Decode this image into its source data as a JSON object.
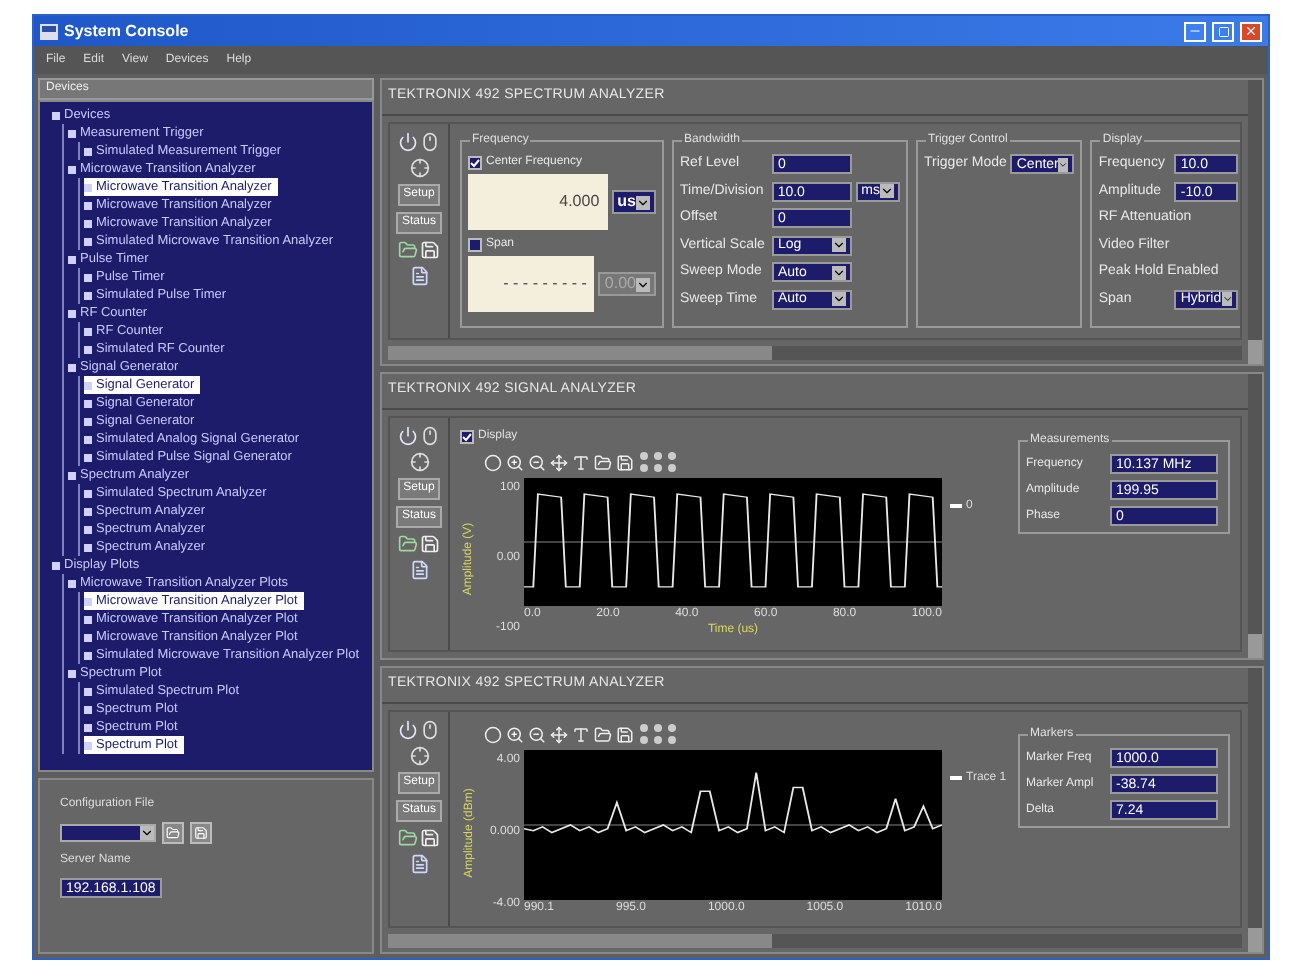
{
  "window": {
    "title": "System Console"
  },
  "menu": [
    "File",
    "Edit",
    "View",
    "Devices",
    "Help"
  ],
  "sidebar": {
    "tab": "Devices",
    "tree": [
      {
        "label": "Devices",
        "selected": false,
        "children": [
          {
            "label": "Measurement Trigger",
            "selected": false,
            "children": [
              {
                "label": "Simulated Measurement Trigger",
                "selected": false
              }
            ]
          },
          {
            "label": "Microwave Transition Analyzer",
            "selected": false,
            "children": [
              {
                "label": "Microwave Transition Analyzer",
                "selected": true
              },
              {
                "label": "Microwave Transition Analyzer",
                "selected": false
              },
              {
                "label": "Microwave Transition Analyzer",
                "selected": false
              },
              {
                "label": "Simulated Microwave Transition Analyzer",
                "selected": false
              }
            ]
          },
          {
            "label": "Pulse Timer",
            "selected": false,
            "children": [
              {
                "label": "Pulse Timer",
                "selected": false
              },
              {
                "label": "Simulated Pulse Timer",
                "selected": false
              }
            ]
          },
          {
            "label": "RF Counter",
            "selected": false,
            "children": [
              {
                "label": "RF Counter",
                "selected": false
              },
              {
                "label": "Simulated RF Counter",
                "selected": false
              }
            ]
          },
          {
            "label": "Signal Generator",
            "selected": false,
            "children": [
              {
                "label": "Signal Generator",
                "selected": true
              },
              {
                "label": "Signal Generator",
                "selected": false
              },
              {
                "label": "Signal Generator",
                "selected": false
              },
              {
                "label": "Simulated Analog Signal Generator",
                "selected": false
              },
              {
                "label": "Simulated Pulse Signal Generator",
                "selected": false
              }
            ]
          },
          {
            "label": "Spectrum Analyzer",
            "selected": false,
            "children": [
              {
                "label": "Simulated Spectrum Analyzer",
                "selected": false
              },
              {
                "label": "Spectrum Analyzer",
                "selected": false
              },
              {
                "label": "Spectrum Analyzer",
                "selected": false
              },
              {
                "label": "Spectrum Analyzer",
                "selected": false
              }
            ]
          }
        ]
      },
      {
        "label": "Display Plots",
        "selected": false,
        "children": [
          {
            "label": "Microwave Transition Analyzer Plots",
            "selected": false,
            "children": [
              {
                "label": "Microwave Transition Analyzer Plot",
                "selected": true
              },
              {
                "label": "Microwave Transition Analyzer Plot",
                "selected": false
              },
              {
                "label": "Microwave Transition Analyzer Plot",
                "selected": false
              },
              {
                "label": "Simulated Microwave Transition Analyzer Plot",
                "selected": false
              }
            ]
          },
          {
            "label": "Spectrum Plot",
            "selected": false,
            "children": [
              {
                "label": "Simulated Spectrum Plot",
                "selected": false
              },
              {
                "label": "Spectrum Plot",
                "selected": false
              },
              {
                "label": "Spectrum Plot",
                "selected": false
              },
              {
                "label": "Spectrum Plot",
                "selected": true
              }
            ]
          }
        ]
      }
    ],
    "config_label": "Configuration File",
    "server_label": "Server Name",
    "server_value": "192.168.1.108"
  },
  "panels": [
    {
      "kind": "settings",
      "title": "TEKTRONIX 492 SPECTRUM ANALYZER",
      "side_buttons": [
        "Setup",
        "Status"
      ],
      "frequency": {
        "title": "Frequency",
        "options": [
          {
            "label": "Center Frequency",
            "checked": true,
            "display": "4.000",
            "unit": "us"
          },
          {
            "label": "Span",
            "checked": false,
            "display": "- - - - - - - - -",
            "unit": "0.00"
          }
        ]
      },
      "groups": [
        {
          "title": "Bandwidth",
          "fields": [
            {
              "kind": "text",
              "label": "Ref Level",
              "value": "0"
            },
            {
              "kind": "text",
              "label": "Time/Division",
              "value": "10.0",
              "unit": "ms"
            },
            {
              "kind": "text",
              "label": "Offset",
              "value": "0"
            },
            {
              "kind": "select",
              "label": "Vertical Scale",
              "value": "Log"
            },
            {
              "kind": "select",
              "label": "Sweep Mode",
              "value": "Auto"
            },
            {
              "kind": "select",
              "label": "Sweep Time",
              "value": "Auto"
            }
          ]
        },
        {
          "title": "Trigger Control",
          "fields": [
            {
              "kind": "select",
              "label": "Trigger Mode",
              "value": "Center"
            }
          ]
        },
        {
          "title": "Display",
          "fields": [
            {
              "kind": "text",
              "label": "Frequency",
              "value": "10.0"
            },
            {
              "kind": "text",
              "label": "Amplitude",
              "value": "-10.0"
            },
            {
              "kind": "label",
              "label": "RF Attenuation"
            },
            {
              "kind": "label",
              "label": "Video Filter"
            },
            {
              "kind": "label",
              "label": "Peak Hold Enabled"
            },
            {
              "kind": "select",
              "label": "Span",
              "value": "Hybrid"
            }
          ]
        }
      ]
    },
    {
      "kind": "plot",
      "title": "TEKTRONIX 492 SIGNAL ANALYZER",
      "side_buttons": [
        "Setup",
        "Status"
      ],
      "display_toggle": {
        "label": "Display",
        "checked": true
      },
      "trace": {
        "kind": "square"
      },
      "y_label": "Amplitude (V)",
      "x_label": "Time (us)",
      "y_ticks": [
        "100",
        "0.00",
        "-100"
      ],
      "x_ticks": [
        "0.0",
        "20.0",
        "40.0",
        "60.0",
        "80.0",
        "100.0"
      ],
      "legend": "0",
      "readouts": {
        "title": "Measurements",
        "fields": [
          {
            "label": "Frequency",
            "value": "10.137 MHz"
          },
          {
            "label": "Amplitude",
            "value": "199.95"
          },
          {
            "label": "Phase",
            "value": "0"
          }
        ]
      }
    },
    {
      "kind": "plot",
      "title": "TEKTRONIX 492 SPECTRUM ANALYZER",
      "side_buttons": [
        "Setup",
        "Status"
      ],
      "trace": {
        "kind": "spikes"
      },
      "y_label": "Amplitude (dBm)",
      "y_ticks": [
        "4.00",
        "0.000",
        "-4.00"
      ],
      "x_ticks": [
        "990.1",
        "995.0",
        "1000.0",
        "1005.0",
        "1010.0"
      ],
      "legend": "Trace 1",
      "readouts": {
        "title": "Markers",
        "fields": [
          {
            "label": "Marker Freq",
            "value": "1000.0"
          },
          {
            "label": "Marker Ampl",
            "value": "-38.74"
          },
          {
            "label": "Delta",
            "value": "7.24"
          }
        ]
      }
    }
  ]
}
